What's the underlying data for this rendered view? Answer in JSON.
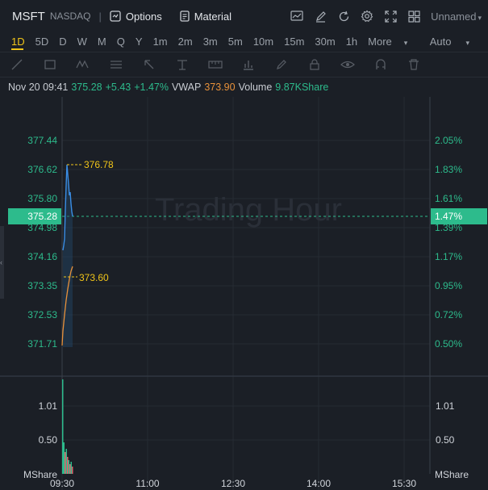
{
  "header": {
    "symbol": "MSFT",
    "exchange": "NASDAQ",
    "options_label": "Options",
    "material_label": "Material",
    "layout_name": "Unnamed"
  },
  "timeframes": [
    "1D",
    "5D",
    "D",
    "W",
    "M",
    "Q",
    "Y",
    "1m",
    "2m",
    "3m",
    "5m",
    "10m",
    "15m",
    "30m",
    "1h"
  ],
  "more_label": "More",
  "auto_label": "Auto",
  "quote": {
    "datetime": "Nov 20 09:41",
    "price": "375.28",
    "change": "+5.43",
    "change_pct": "+1.47%",
    "vwap_label": "VWAP",
    "vwap_value": "373.90",
    "volume_label": "Volume",
    "volume_value": "9.87KShare"
  },
  "watermark": "Trading Hour",
  "colors": {
    "up": "#2dbb8c",
    "price_line": "#3a8ee6",
    "vwap_line": "#e8913a",
    "highlow": "#f0c419",
    "bg": "#1b1f26"
  },
  "price_axis": {
    "left_ticks": [
      "377.44",
      "376.62",
      "375.80",
      "374.98",
      "374.16",
      "373.35",
      "372.53",
      "371.71"
    ],
    "right_ticks": [
      "2.05%",
      "1.83%",
      "1.61%",
      "1.39%",
      "1.17%",
      "0.95%",
      "0.72%",
      "0.50%"
    ],
    "current_price": "375.28",
    "current_pct": "1.47%",
    "high_label": "376.78",
    "low_label": "373.60"
  },
  "volume_axis": {
    "ticks": [
      "1.01",
      "0.50"
    ],
    "unit": "MShare"
  },
  "time_axis": [
    "09:30",
    "11:00",
    "12:30",
    "14:00",
    "15:30"
  ]
}
